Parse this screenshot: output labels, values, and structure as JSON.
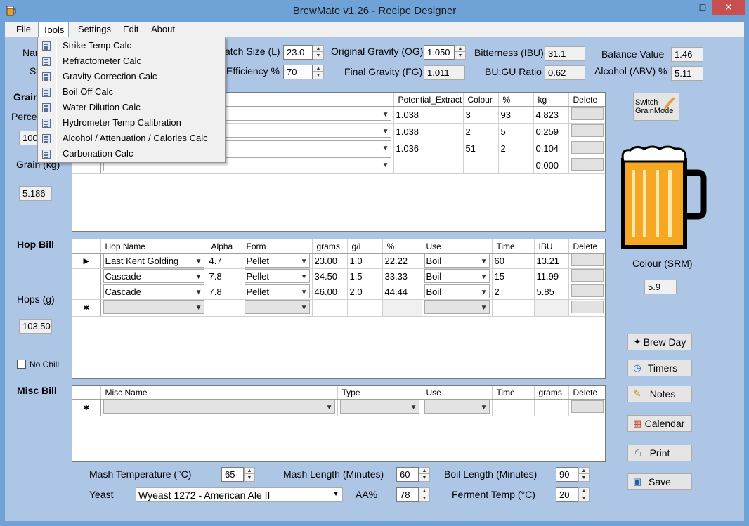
{
  "window": {
    "title": "BrewMate v1.26 - Recipe Designer",
    "min": "–",
    "max": "□",
    "close": "✕"
  },
  "menu": [
    "File",
    "Tools",
    "Settings",
    "Edit",
    "About"
  ],
  "tools_menu": [
    "Strike Temp Calc",
    "Refractometer Calc",
    "Gravity Correction Calc",
    "Boil Off Calc",
    "Water Dilution Calc",
    "Hydrometer Temp Calibration",
    "Alcohol / Attenuation / Calories Calc",
    "Carbonation Calc"
  ],
  "left": {
    "name_label": "Nar",
    "style_label": "St",
    "grain_label": "Grain",
    "percent_label": "Perce",
    "percent_value": "100.",
    "grain_kg_label": "Grain (kg)",
    "grain_kg_value": "5.186",
    "hop_bill": "Hop Bill",
    "hops_g_label": "Hops (g)",
    "hops_g_value": "103.50",
    "no_chill": "No Chill",
    "misc_bill": "Misc Bill"
  },
  "stats": {
    "batch_label": "atch Size (L)",
    "batch_value": "23.0",
    "eff_label": "Efficiency %",
    "eff_value": "70",
    "og_label": "Original Gravity (OG)",
    "og_value": "1.050",
    "fg_label": "Final Gravity (FG)",
    "fg_value": "1.011",
    "ibu_label": "Bitterness (IBU)",
    "ibu_value": "31.1",
    "bugu_label": "BU:GU Ratio",
    "bugu_value": "0.62",
    "balance_label": "Balance Value",
    "balance_value": "1.46",
    "abv_label": "Alcohol (ABV) %",
    "abv_value": "5.11"
  },
  "grain_grid": {
    "headers": [
      "Potential_Extract",
      "Colour",
      "%",
      "kg",
      "Delete"
    ],
    "rows": [
      {
        "extract": "1.038",
        "colour": "3",
        "pct": "93",
        "kg": "4.823"
      },
      {
        "extract": "1.038",
        "colour": "2",
        "pct": "5",
        "kg": "0.259"
      },
      {
        "extract": "1.036",
        "colour": "51",
        "pct": "2",
        "kg": "0.104"
      }
    ],
    "new_kg": "0.000"
  },
  "hop_grid": {
    "headers": [
      "Hop Name",
      "Alpha",
      "Form",
      "grams",
      "g/L",
      "%",
      "Use",
      "Time",
      "IBU",
      "Delete"
    ],
    "rows": [
      {
        "marker": "▶",
        "name": "East Kent Golding",
        "alpha": "4.7",
        "form": "Pellet",
        "grams": "23.00",
        "gl": "1.0",
        "pct": "22.22",
        "use": "Boil",
        "time": "60",
        "ibu": "13.21"
      },
      {
        "marker": "",
        "name": "Cascade",
        "alpha": "7.8",
        "form": "Pellet",
        "grams": "34.50",
        "gl": "1.5",
        "pct": "33.33",
        "use": "Boil",
        "time": "15",
        "ibu": "11.99"
      },
      {
        "marker": "",
        "name": "Cascade",
        "alpha": "7.8",
        "form": "Pellet",
        "grams": "46.00",
        "gl": "2.0",
        "pct": "44.44",
        "use": "Boil",
        "time": "2",
        "ibu": "5.85"
      }
    ],
    "new_marker": "✱"
  },
  "misc_grid": {
    "headers": [
      "Misc Name",
      "Type",
      "Use",
      "Time",
      "grams",
      "Delete"
    ],
    "new_marker": "✱"
  },
  "right": {
    "switch_btn": "Switch GrainMode",
    "colour_label": "Colour (SRM)",
    "colour_value": "5.9",
    "beer_color": "#f5a623",
    "buttons": [
      "Brew Day",
      "Timers",
      "Notes",
      "Calendar",
      "Print",
      "Save"
    ]
  },
  "bottom": {
    "mash_temp_label": "Mash Temperature (°C)",
    "mash_temp_value": "65",
    "mash_len_label": "Mash Length (Minutes)",
    "mash_len_value": "60",
    "boil_len_label": "Boil Length (Minutes)",
    "boil_len_value": "90",
    "yeast_label": "Yeast",
    "yeast_value": "Wyeast 1272 - American Ale II",
    "aa_label": "AA%",
    "aa_value": "78",
    "ferm_label": "Ferment Temp (°C)",
    "ferm_value": "20"
  },
  "icons": [
    "app-icon",
    "calculator-icon",
    "wheat-icon",
    "beer-mug-icon",
    "wand-icon",
    "stopwatch-icon",
    "pencil-icon",
    "calendar-icon",
    "printer-icon",
    "floppy-icon"
  ]
}
